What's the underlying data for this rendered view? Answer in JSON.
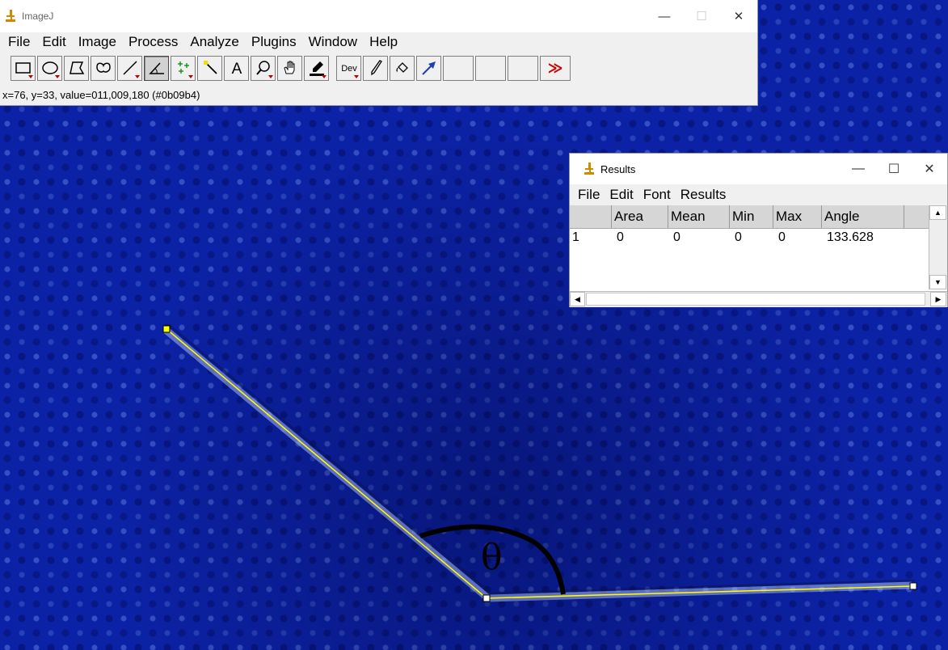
{
  "main_window": {
    "title": "ImageJ",
    "menu": [
      "File",
      "Edit",
      "Image",
      "Process",
      "Analyze",
      "Plugins",
      "Window",
      "Help"
    ],
    "tools": [
      {
        "icon": "rectangle-icon",
        "active": false,
        "dropdown": true
      },
      {
        "icon": "oval-icon",
        "active": false,
        "dropdown": true
      },
      {
        "icon": "polygon-icon",
        "active": false,
        "dropdown": false
      },
      {
        "icon": "freehand-icon",
        "active": false,
        "dropdown": false
      },
      {
        "icon": "line-icon",
        "active": false,
        "dropdown": true
      },
      {
        "icon": "angle-icon",
        "active": true,
        "dropdown": false
      },
      {
        "icon": "multipoint-icon",
        "active": false,
        "dropdown": true
      },
      {
        "icon": "wand-icon",
        "active": false,
        "dropdown": false
      },
      {
        "icon": "text-icon",
        "active": false,
        "dropdown": false
      },
      {
        "icon": "magnifier-icon",
        "active": false,
        "dropdown": true
      },
      {
        "icon": "hand-icon",
        "active": false,
        "dropdown": false
      },
      {
        "icon": "color-picker-icon",
        "active": false,
        "dropdown": true
      },
      {
        "icon": "developer-menu-icon",
        "label": "Dev",
        "active": false,
        "dropdown": true
      },
      {
        "icon": "brush-icon",
        "active": false,
        "dropdown": false
      },
      {
        "icon": "flood-fill-icon",
        "active": false,
        "dropdown": false
      },
      {
        "icon": "arrow-icon",
        "active": false,
        "dropdown": false
      },
      {
        "icon": "empty-slot",
        "active": false,
        "dropdown": false
      },
      {
        "icon": "empty-slot",
        "active": false,
        "dropdown": false
      },
      {
        "icon": "empty-slot",
        "active": false,
        "dropdown": false
      },
      {
        "icon": "more-tools-icon",
        "label": "≫",
        "active": false,
        "dropdown": false
      }
    ],
    "status": "x=76, y=33, value=011,009,180 (#0b09b4)"
  },
  "results_window": {
    "title": "Results",
    "menu": [
      "File",
      "Edit",
      "Font",
      "Results"
    ],
    "columns": [
      "",
      "Area",
      "Mean",
      "Min",
      "Max",
      "Angle"
    ],
    "rows": [
      [
        "1",
        "0",
        "0",
        "0",
        "0",
        "133.628"
      ]
    ]
  },
  "annotation": {
    "theta": "θ"
  },
  "colors": {
    "background": "#0c22a6",
    "roi_line": "#ffff00",
    "roi_handle": "#ffffff",
    "arc": "#000000",
    "dropdown_marker": "#c00000"
  }
}
